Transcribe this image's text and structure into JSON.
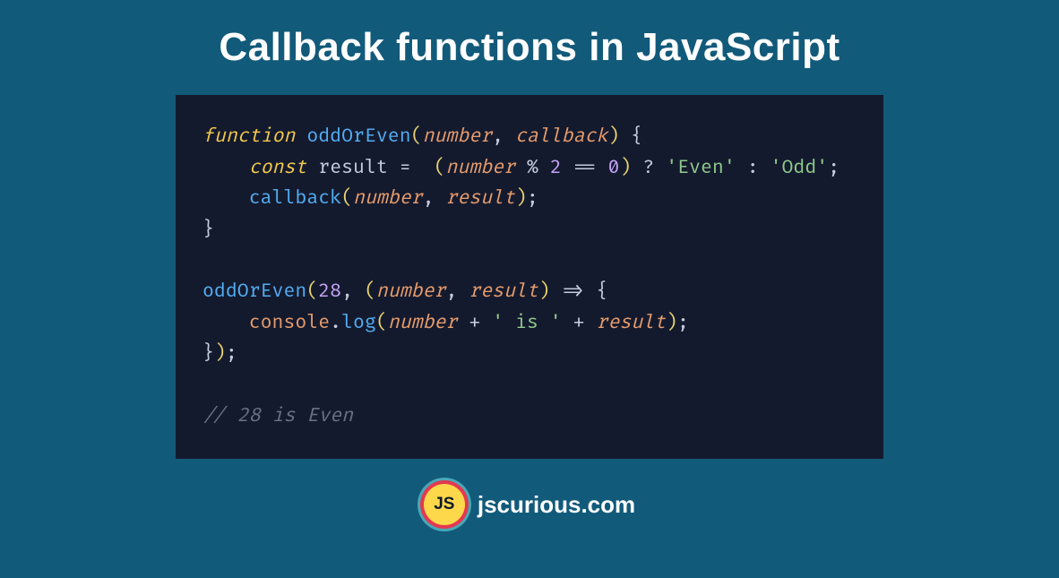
{
  "title": "Callback functions in JavaScript",
  "code": {
    "l1": {
      "kw": "function",
      "fn": "oddOrEven",
      "p1": "number",
      "p2": "callback"
    },
    "l2": {
      "kw": "const",
      "var": "result",
      "p": "number",
      "n2": "2",
      "n0": "0",
      "s1": "'Even'",
      "s2": "'Odd'"
    },
    "l3": {
      "fn": "callback",
      "p1": "number",
      "p2": "result"
    },
    "l5": {
      "fn": "oddOrEven",
      "n": "28",
      "p1": "number",
      "p2": "result"
    },
    "l6": {
      "obj": "console",
      "method": "log",
      "p": "number",
      "s1": "' is '",
      "p2": "result"
    },
    "comment": "// 28 is Even"
  },
  "footer": {
    "logo_text": "JS",
    "site": "jscurious.com"
  }
}
